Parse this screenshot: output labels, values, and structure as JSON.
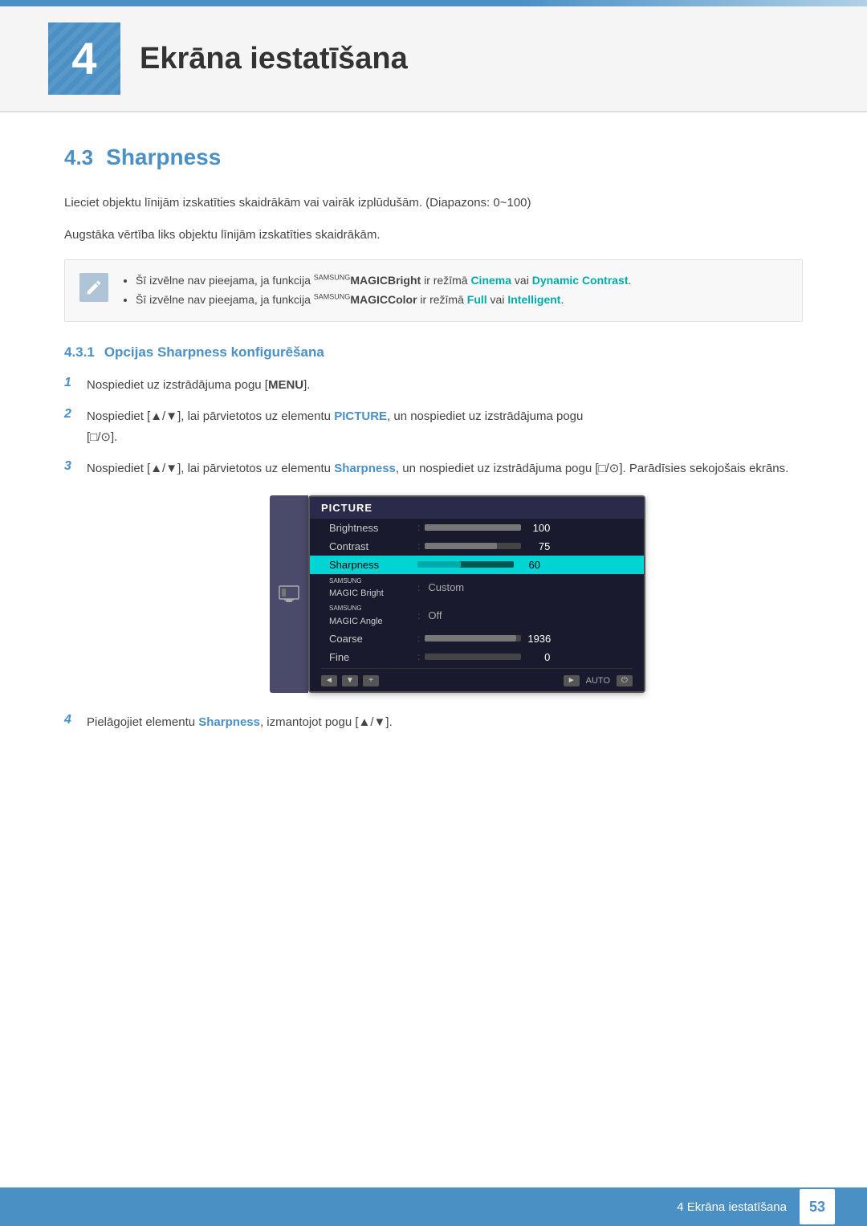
{
  "header": {
    "chapter_number": "4",
    "chapter_title": "Ekrāna iestatīšana"
  },
  "section": {
    "number": "4.3",
    "title": "Sharpness"
  },
  "intro": {
    "line1": "Lieciet objektu līnijām izskatīties skaidrākām vai vairāk izplūdušām. (Diapazons: 0~100)",
    "line2": "Augstāka vērtība liks objektu līnijām izskatīties skaidrākām."
  },
  "notes": [
    {
      "text_prefix": "Šī izvēlne nav pieejama, ja funkcija ",
      "brand1": "SAMSUNG",
      "brand2": "MAGIC",
      "func1": "Bright",
      "text_mid": " ir režīmā ",
      "mode1": "Cinema",
      "text_or": " vai ",
      "mode2": "Dynamic Contrast",
      "text_end": "."
    },
    {
      "text_prefix": "Šī izvēlne nav pieejama, ja funkcija ",
      "brand1": "SAMSUNG",
      "brand2": "MAGIC",
      "func1": "Color",
      "text_mid": " ir režīmā ",
      "mode1": "Full",
      "text_or": " vai ",
      "mode2": "Intelligent",
      "text_end": "."
    }
  ],
  "subsection": {
    "number": "4.3.1",
    "title": "Opcijas Sharpness konfigurēšana"
  },
  "steps": [
    {
      "num": "1",
      "text_prefix": "Nospiediet uz izstrādājuma pogu [",
      "bold_text": "MENU",
      "text_suffix": "]."
    },
    {
      "num": "2",
      "text_prefix": "Nospiediet [▲/▼], lai pārvietotos uz elementu ",
      "bold_text": "PICTURE",
      "text_mid": ", un nospiediet uz izstrādājuma pogu [□/⊙]."
    },
    {
      "num": "3",
      "text_prefix": "Nospiediet [▲/▼], lai pārvietotos uz elementu ",
      "bold_text": "Sharpness",
      "text_mid": ", un nospiediet uz izstrādājuma pogu [□/⊙]. Parādīsies sekojošais ekrāns."
    },
    {
      "num": "4",
      "text_prefix": "Pielāgojiet elementu ",
      "bold_text": "Sharpness",
      "text_suffix": ", izmantojot pogu [▲/▼]."
    }
  ],
  "monitor_menu": {
    "title": "PICTURE",
    "items": [
      {
        "label": "Brightness",
        "type": "bar",
        "fill": 100,
        "value": "100"
      },
      {
        "label": "Contrast",
        "type": "bar",
        "fill": 75,
        "value": "75"
      },
      {
        "label": "Sharpness",
        "type": "bar_highlight",
        "fill": 45,
        "value": "60"
      },
      {
        "label": "SAMSUNG\nMAGIC Bright",
        "type": "text",
        "value": "Custom"
      },
      {
        "label": "SAMSUNG\nMAGIC Angle",
        "type": "text",
        "value": "Off"
      },
      {
        "label": "Coarse",
        "type": "bar",
        "fill": 100,
        "value": "1936"
      },
      {
        "label": "Fine",
        "type": "bar",
        "fill": 0,
        "value": "0"
      }
    ]
  },
  "footer": {
    "text": "4 Ekrāna iestatīšana",
    "page": "53"
  }
}
